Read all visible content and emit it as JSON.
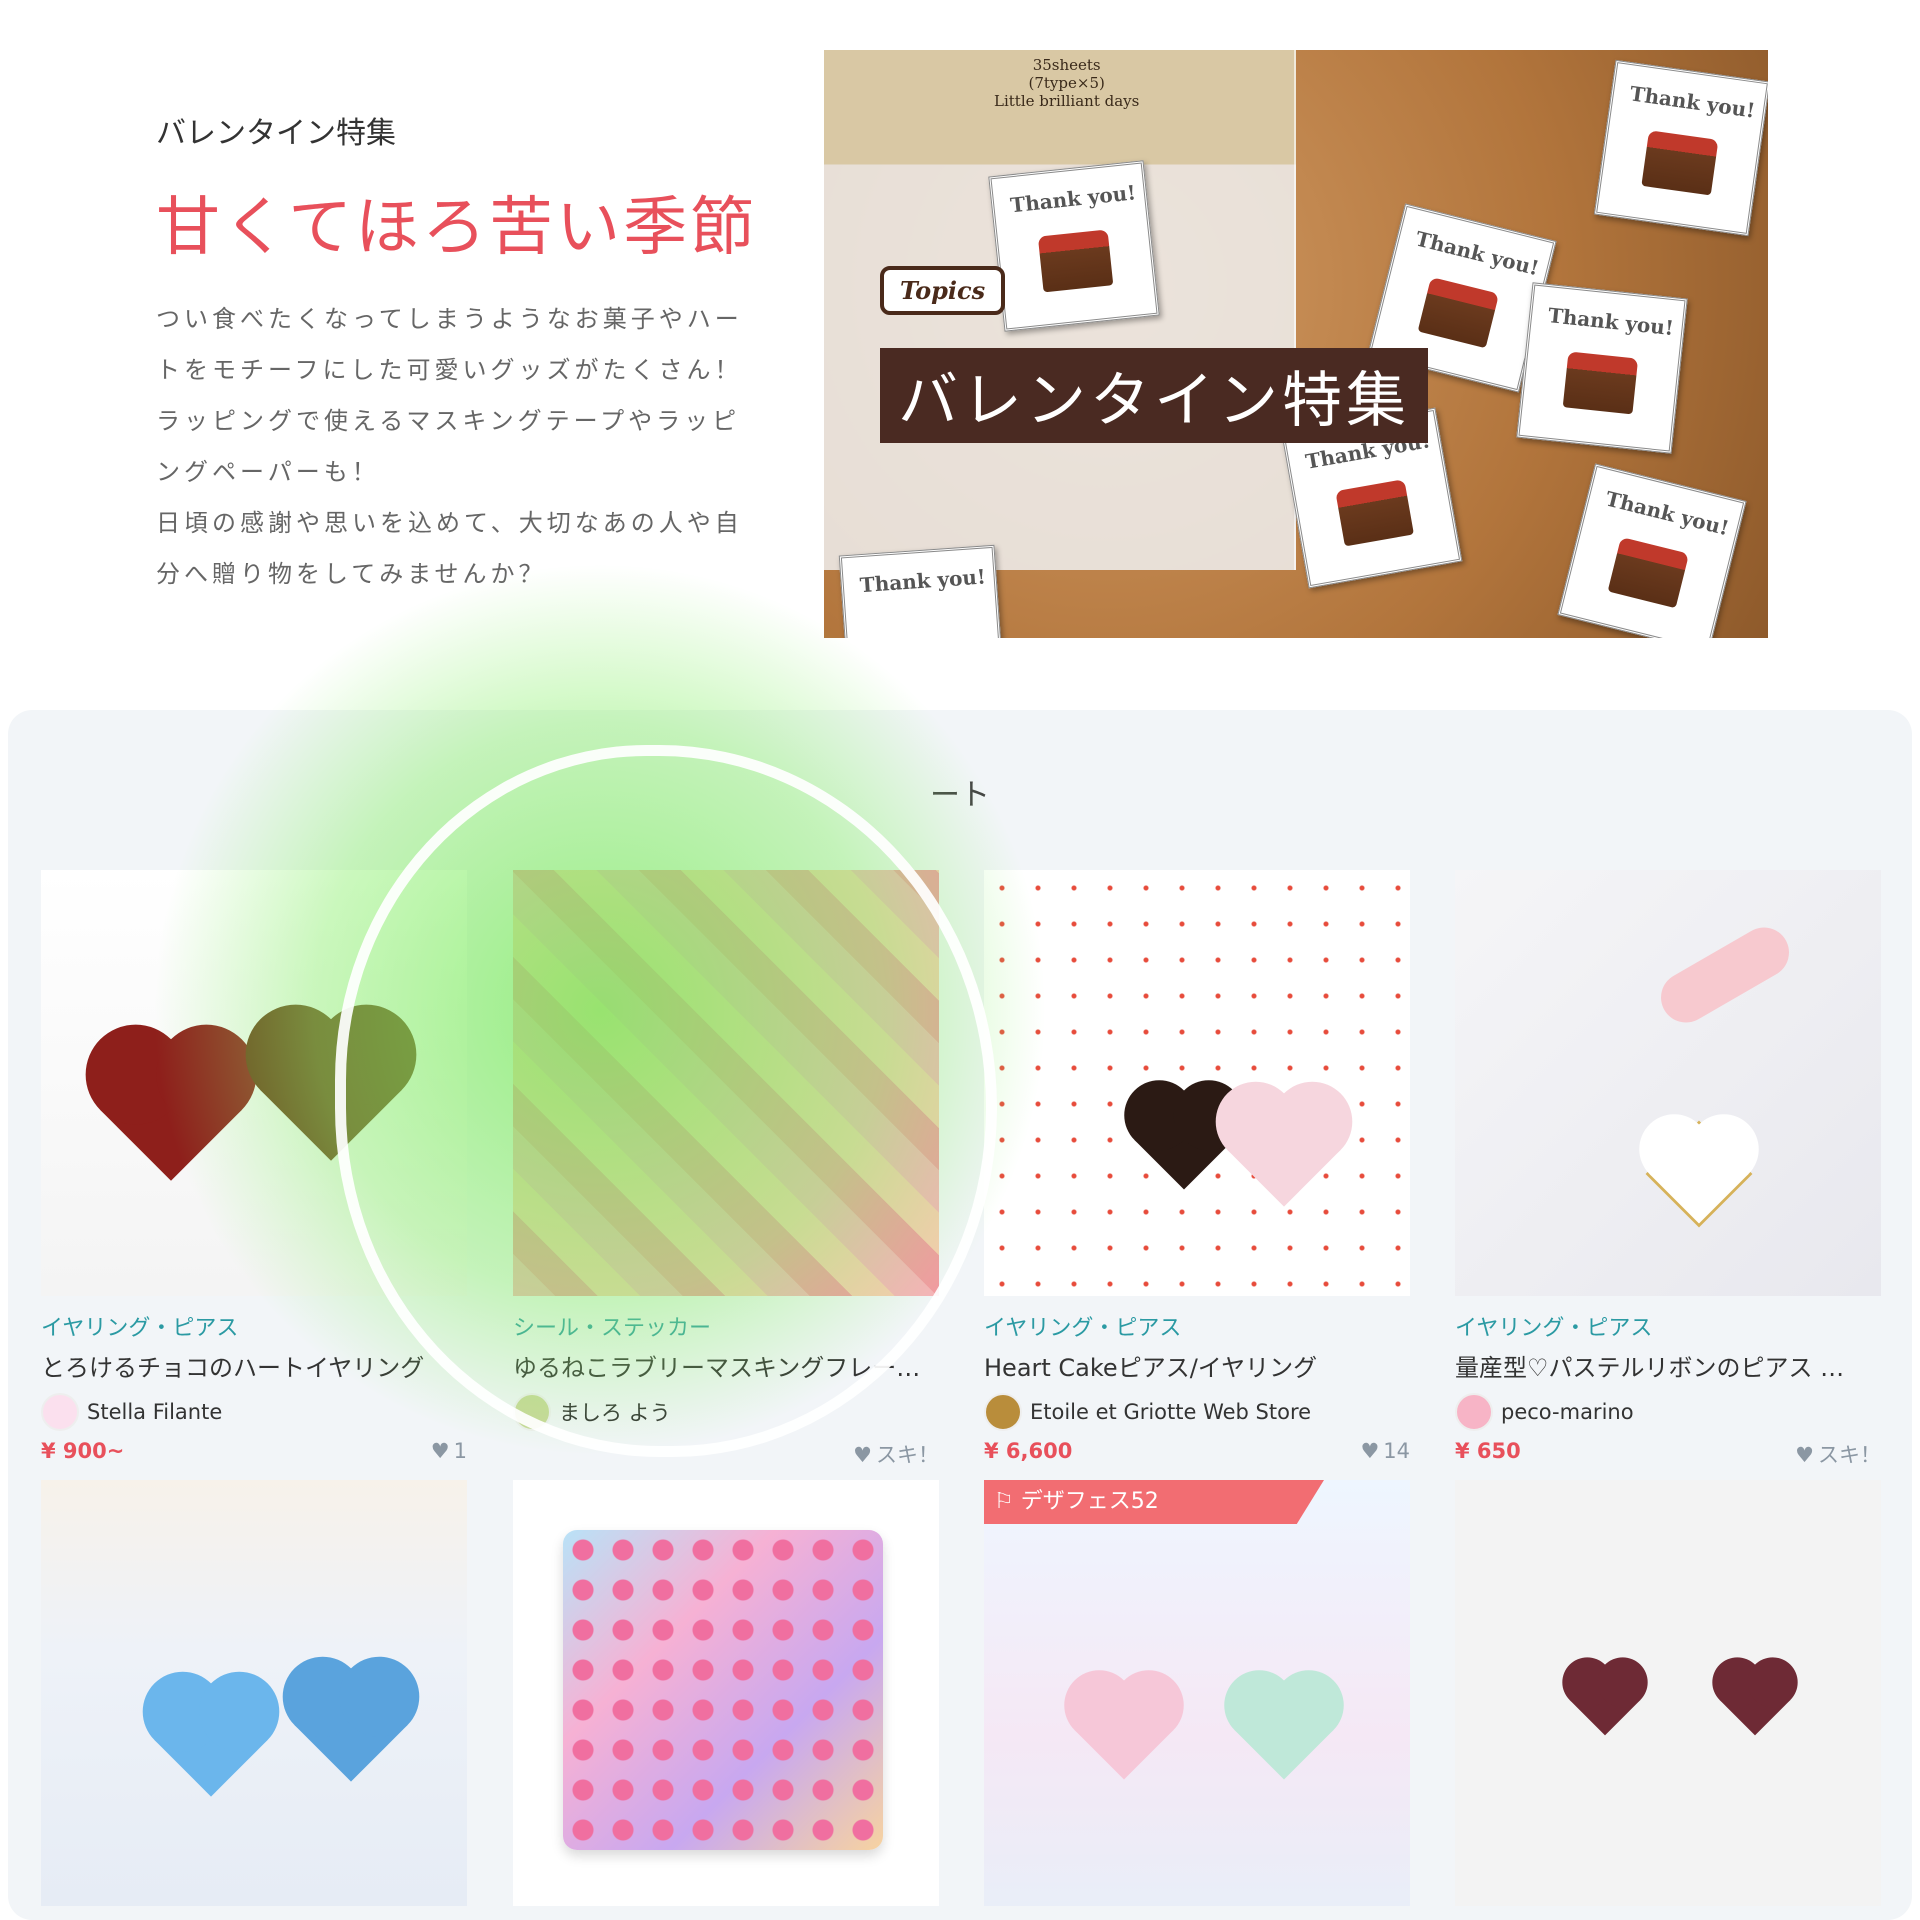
{
  "hero": {
    "kicker": "バレンタイン特集",
    "title": "甘くてほろ苦い季節",
    "description": "つい食べたくなってしまうようなお菓子やハー\nトをモチーフにした可愛いグッズがたくさん！\nラッピングで使えるマスキングテープやラッピ\nングペーパーも！\n日頃の感謝や思いを込めて、大切なあの人や自\n分へ贈り物をしてみませんか？",
    "image": {
      "bag_label": "35sheets\n(7type×5)\nLittle brilliant days",
      "card_text": "Thank you!",
      "badge": "Topics",
      "banner_title": "バレンタイン特集"
    }
  },
  "section": {
    "title_visible": "ート"
  },
  "items": [
    {
      "category": "イヤリング・ピアス",
      "name": "とろけるチョコのハートイヤリング",
      "shop": "Stella Filante",
      "price": "¥ 900~",
      "likes": "1"
    },
    {
      "category": "シール・ステッカー",
      "name": "ゆるねこラブリーマスキングフレー…",
      "shop": "ましろ よう",
      "price": "",
      "likes": "スキ！"
    },
    {
      "category": "イヤリング・ピアス",
      "name": "Heart Cakeピアス/イヤリング",
      "shop": "Etoile et Griotte Web Store",
      "price": "¥ 6,600",
      "likes": "14"
    },
    {
      "category": "イヤリング・ピアス",
      "name": "量産型♡パステルリボンのピアス …",
      "shop": "peco-marino",
      "price": "¥ 650",
      "likes": "スキ！"
    }
  ],
  "row2": {
    "flag": "デザフェス52"
  },
  "icons": {
    "heart": "heart-icon",
    "flag": "flag-icon"
  },
  "colors": {
    "accent": "#e8505b",
    "category": "#2b9aa3",
    "annotation_glow": "#7be85a"
  }
}
